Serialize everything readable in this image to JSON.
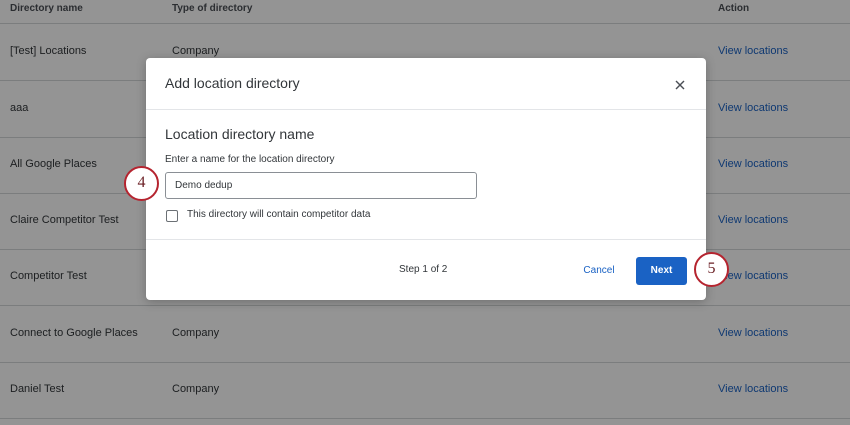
{
  "table": {
    "headers": {
      "name": "Directory name",
      "type": "Type of directory",
      "action": "Action"
    },
    "rows": [
      {
        "name": "[Test] Locations",
        "type": "Company",
        "action": "View locations"
      },
      {
        "name": "aaa",
        "type": "",
        "action": "View locations"
      },
      {
        "name": "All Google Places",
        "type": "",
        "action": "View locations"
      },
      {
        "name": "Claire Competitor Test",
        "type": "",
        "action": "View locations"
      },
      {
        "name": "Competitor Test",
        "type": "",
        "action": "View locations"
      },
      {
        "name": "Connect to Google Places",
        "type": "Company",
        "action": "View locations"
      },
      {
        "name": "Daniel Test",
        "type": "Company",
        "action": "View locations"
      }
    ]
  },
  "modal": {
    "title": "Add location directory",
    "close_icon": "close-icon",
    "section_title": "Location directory name",
    "field_label": "Enter a name for the location directory",
    "field_value": "Demo dedup",
    "checkbox_label": "This directory will contain competitor data",
    "checkbox_checked": false,
    "step": "Step 1 of 2",
    "cancel_label": "Cancel",
    "next_label": "Next"
  },
  "callouts": {
    "first": "4",
    "second": "5"
  },
  "colors": {
    "link": "#1a62c4",
    "primary_button": "#1a62c4",
    "callout_border": "#b5242f",
    "overlay": "rgba(0,0,0,0.42)"
  }
}
